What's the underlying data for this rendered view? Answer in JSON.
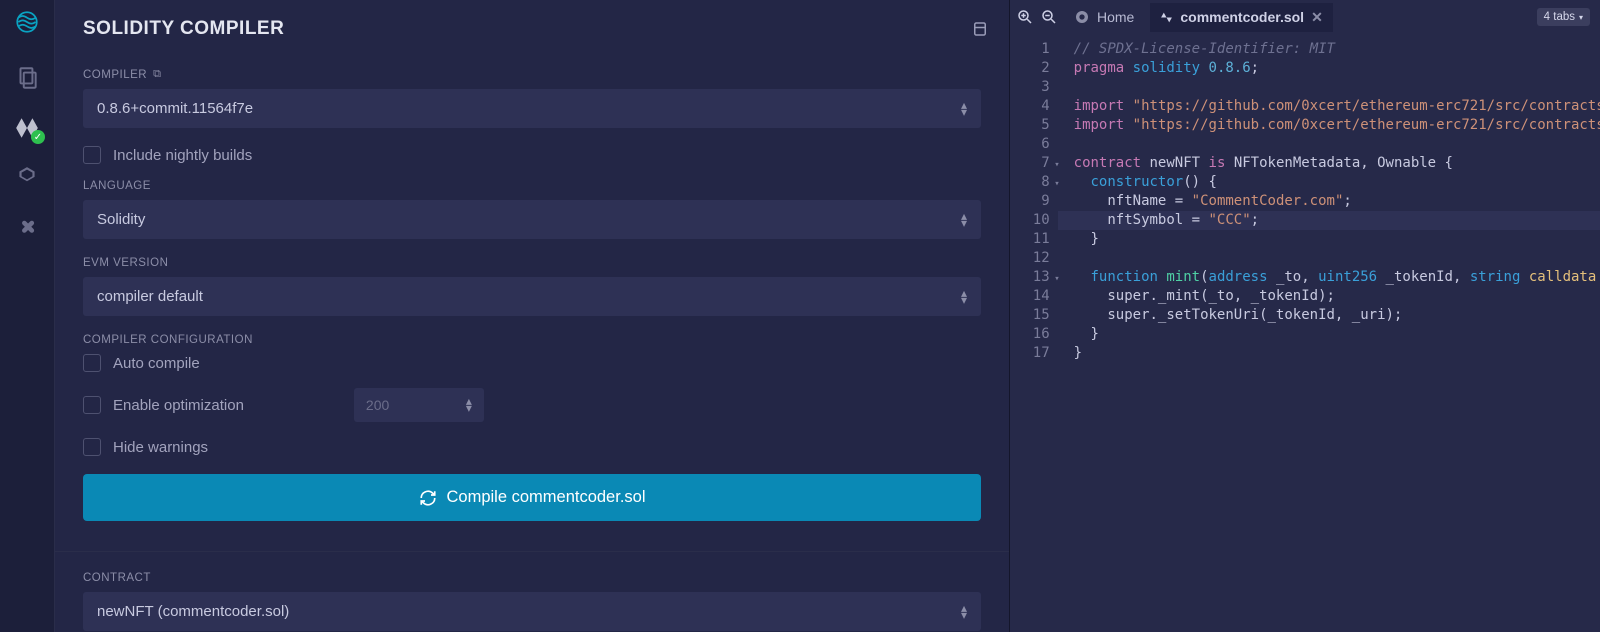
{
  "sidebar": {
    "icons": [
      "logo",
      "files",
      "solidity",
      "deploy",
      "plugin"
    ]
  },
  "panel": {
    "title": "SOLIDITY COMPILER",
    "compiler_label": "COMPILER",
    "compiler_value": "0.8.6+commit.11564f7e",
    "nightly_label": "Include nightly builds",
    "language_label": "LANGUAGE",
    "language_value": "Solidity",
    "evm_label": "EVM VERSION",
    "evm_value": "compiler default",
    "config_label": "COMPILER CONFIGURATION",
    "auto_label": "Auto compile",
    "optimize_label": "Enable optimization",
    "optimize_value": "200",
    "hide_label": "Hide warnings",
    "compile_btn": "Compile commentcoder.sol",
    "contract_label": "CONTRACT",
    "contract_value": "newNFT (commentcoder.sol)"
  },
  "editor": {
    "home_tab": "Home",
    "active_tab": "commentcoder.sol",
    "tabs_badge": "4 tabs",
    "code": [
      {
        "n": 1,
        "f": false,
        "t": [
          [
            "c-comment",
            "// SPDX-License-Identifier: MIT"
          ]
        ]
      },
      {
        "n": 2,
        "f": false,
        "t": [
          [
            "c-kw",
            "pragma "
          ],
          [
            "c-kw2",
            "solidity "
          ],
          [
            "c-num",
            "0.8.6"
          ],
          [
            "c-plain",
            ";"
          ]
        ]
      },
      {
        "n": 3,
        "f": false,
        "t": [
          [
            "",
            ""
          ]
        ]
      },
      {
        "n": 4,
        "f": false,
        "t": [
          [
            "c-kw",
            "import "
          ],
          [
            "c-str",
            "\"https://github.com/0xcert/ethereum-erc721/src/contracts"
          ]
        ]
      },
      {
        "n": 5,
        "f": false,
        "t": [
          [
            "c-kw",
            "import "
          ],
          [
            "c-str",
            "\"https://github.com/0xcert/ethereum-erc721/src/contracts"
          ]
        ]
      },
      {
        "n": 6,
        "f": false,
        "t": [
          [
            "",
            ""
          ]
        ]
      },
      {
        "n": 7,
        "f": true,
        "t": [
          [
            "c-kw",
            "contract "
          ],
          [
            "c-plain",
            "newNFT "
          ],
          [
            "c-kw",
            "is "
          ],
          [
            "c-plain",
            "NFTokenMetadata, Ownable {"
          ]
        ]
      },
      {
        "n": 8,
        "f": true,
        "t": [
          [
            "c-plain",
            "  "
          ],
          [
            "c-kw2",
            "constructor"
          ],
          [
            "c-plain",
            "() {"
          ]
        ]
      },
      {
        "n": 9,
        "f": false,
        "t": [
          [
            "c-plain",
            "    nftName = "
          ],
          [
            "c-str",
            "\"CommentCoder.com\""
          ],
          [
            "c-plain",
            ";"
          ]
        ]
      },
      {
        "n": 10,
        "f": false,
        "hl": true,
        "t": [
          [
            "c-plain",
            "    nftSymbol = "
          ],
          [
            "c-str",
            "\"CCC\""
          ],
          [
            "c-plain",
            ";"
          ]
        ]
      },
      {
        "n": 11,
        "f": false,
        "t": [
          [
            "c-plain",
            "  }"
          ]
        ]
      },
      {
        "n": 12,
        "f": false,
        "t": [
          [
            "",
            ""
          ]
        ]
      },
      {
        "n": 13,
        "f": true,
        "t": [
          [
            "c-plain",
            "  "
          ],
          [
            "c-kw2",
            "function "
          ],
          [
            "c-fn",
            "mint"
          ],
          [
            "c-plain",
            "("
          ],
          [
            "c-type",
            "address "
          ],
          [
            "c-plain",
            "_to, "
          ],
          [
            "c-type",
            "uint256 "
          ],
          [
            "c-plain",
            "_tokenId, "
          ],
          [
            "c-type",
            "string "
          ],
          [
            "c-mod",
            "calldata"
          ]
        ]
      },
      {
        "n": 14,
        "f": false,
        "t": [
          [
            "c-plain",
            "    super._mint(_to, _tokenId);"
          ]
        ]
      },
      {
        "n": 15,
        "f": false,
        "t": [
          [
            "c-plain",
            "    super._setTokenUri(_tokenId, _uri);"
          ]
        ]
      },
      {
        "n": 16,
        "f": false,
        "t": [
          [
            "c-plain",
            "  }"
          ]
        ]
      },
      {
        "n": 17,
        "f": false,
        "t": [
          [
            "c-plain",
            "}"
          ]
        ]
      }
    ]
  }
}
